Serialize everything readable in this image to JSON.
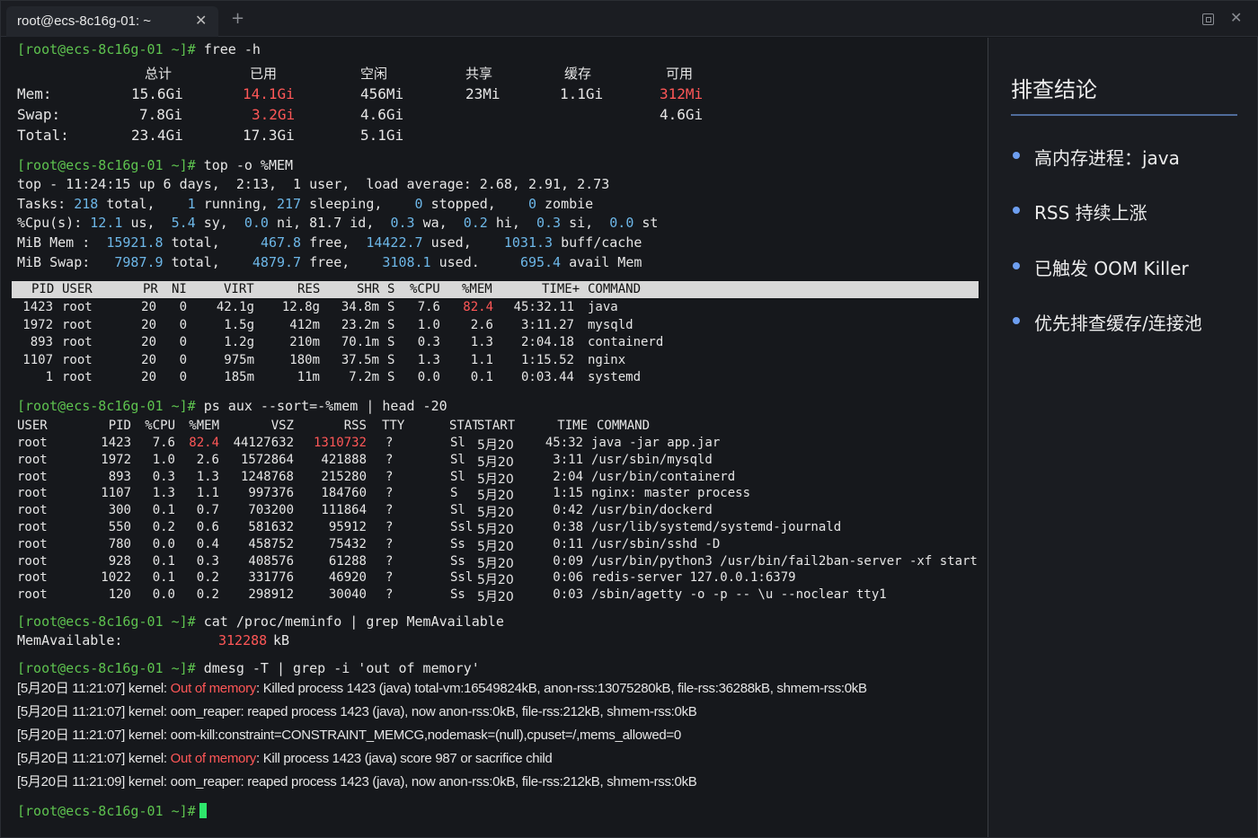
{
  "tab": {
    "title": "root@ecs-8c16g-01: ~",
    "close": "✕",
    "new": "+"
  },
  "window": {
    "close": "✕"
  },
  "prompt": "[root@ecs-8c16g-01 ~]#",
  "free": {
    "cmd": "free -h",
    "headers": [
      "总计",
      "已用",
      "空闲",
      "共享",
      "缓存",
      "可用"
    ],
    "mem": {
      "label": "Mem:",
      "total": "15.6Gi",
      "used": "14.1Gi",
      "free": "456Mi",
      "shared": "23Mi",
      "cache": "1.1Gi",
      "avail": "312Mi"
    },
    "swap": {
      "label": "Swap:",
      "total": "7.8Gi",
      "used": "3.2Gi",
      "free": "4.6Gi",
      "avail": "4.6Gi"
    },
    "total": {
      "label": "Total:",
      "total": "23.4Gi",
      "used": "17.3Gi",
      "free": "5.1Gi"
    }
  },
  "top": {
    "cmd": "top -o %MEM",
    "summary": "top - 11:24:15 up 6 days,  2:13,  1 user,  load average: 2.68, 2.91, 2.73",
    "tasks": {
      "label": "Tasks:",
      "total": "218",
      "total_l": "total,",
      "running": "1",
      "running_l": "running,",
      "sleeping": "217",
      "sleeping_l": "sleeping,",
      "stopped": "0",
      "stopped_l": "stopped,",
      "zombie": "0",
      "zombie_l": "zombie"
    },
    "cpu": {
      "label": "%Cpu(s):",
      "us": "12.1",
      "us_l": "us,",
      "sy": "5.4",
      "sy_l": "sy,",
      "ni": "0.0",
      "ni_l": "ni,",
      "id": "81.7",
      "id_l": "id,",
      "wa": "0.3",
      "wa_l": "wa,",
      "hi": "0.2",
      "hi_l": "hi,",
      "si": "0.3",
      "si_l": "si,",
      "st": "0.0",
      "st_l": "st"
    },
    "mem": {
      "label": "MiB Mem :",
      "total": "15921.8",
      "total_l": "total,",
      "free": "467.8",
      "free_l": "free,",
      "used": "14422.7",
      "used_l": "used,",
      "buff": "1031.3",
      "buff_l": "buff/cache"
    },
    "swap": {
      "label": "MiB Swap:",
      "total": "7987.9",
      "total_l": "total,",
      "free": "4879.7",
      "free_l": "free,",
      "used": "3108.1",
      "used_l": "used.",
      "avail": "695.4",
      "avail_l": "avail Mem"
    },
    "columns": [
      "PID",
      "USER",
      "PR",
      "NI",
      "VIRT",
      "RES",
      "SHR",
      "S",
      "%CPU",
      "%MEM",
      "TIME+",
      "COMMAND"
    ],
    "rows": [
      [
        "1423",
        "root",
        "20",
        "0",
        "42.1g",
        "12.8g",
        "34.8m",
        "S",
        "7.6",
        "82.4",
        "45:32.11",
        "java"
      ],
      [
        "1972",
        "root",
        "20",
        "0",
        "1.5g",
        "412m",
        "23.2m",
        "S",
        "1.0",
        "2.6",
        "3:11.27",
        "mysqld"
      ],
      [
        "893",
        "root",
        "20",
        "0",
        "1.2g",
        "210m",
        "70.1m",
        "S",
        "0.3",
        "1.3",
        "2:04.18",
        "containerd"
      ],
      [
        "1107",
        "root",
        "20",
        "0",
        "975m",
        "180m",
        "37.5m",
        "S",
        "1.3",
        "1.1",
        "1:15.52",
        "nginx"
      ],
      [
        "1",
        "root",
        "20",
        "0",
        "185m",
        "11m",
        "7.2m",
        "S",
        "0.0",
        "0.1",
        "0:03.44",
        "systemd"
      ]
    ]
  },
  "ps": {
    "cmd": "ps aux --sort=-%mem | head -20",
    "columns": [
      "USER",
      "PID",
      "%CPU",
      "%MEM",
      "VSZ",
      "RSS",
      "TTY",
      "STAT",
      "START",
      "TIME",
      "COMMAND"
    ],
    "rows": [
      [
        "root",
        "1423",
        "7.6",
        "82.4",
        "44127632",
        "1310732",
        "?",
        "Sl",
        "5月20",
        "45:32",
        "java -jar app.jar"
      ],
      [
        "root",
        "1972",
        "1.0",
        "2.6",
        "1572864",
        "421888",
        "?",
        "Sl",
        "5月20",
        "3:11",
        "/usr/sbin/mysqld"
      ],
      [
        "root",
        "893",
        "0.3",
        "1.3",
        "1248768",
        "215280",
        "?",
        "Sl",
        "5月20",
        "2:04",
        "/usr/bin/containerd"
      ],
      [
        "root",
        "1107",
        "1.3",
        "1.1",
        "997376",
        "184760",
        "?",
        "S",
        "5月20",
        "1:15",
        "nginx: master process"
      ],
      [
        "root",
        "300",
        "0.1",
        "0.7",
        "703200",
        "111864",
        "?",
        "Sl",
        "5月20",
        "0:42",
        "/usr/bin/dockerd"
      ],
      [
        "root",
        "550",
        "0.2",
        "0.6",
        "581632",
        "95912",
        "?",
        "Ssl",
        "5月20",
        "0:38",
        "/usr/lib/systemd/systemd-journald"
      ],
      [
        "root",
        "780",
        "0.0",
        "0.4",
        "458752",
        "75432",
        "?",
        "Ss",
        "5月20",
        "0:11",
        "/usr/sbin/sshd -D"
      ],
      [
        "root",
        "928",
        "0.1",
        "0.3",
        "408576",
        "61288",
        "?",
        "Ss",
        "5月20",
        "0:09",
        "/usr/bin/python3 /usr/bin/fail2ban-server -xf start"
      ],
      [
        "root",
        "1022",
        "0.1",
        "0.2",
        "331776",
        "46920",
        "?",
        "Ssl",
        "5月20",
        "0:06",
        "redis-server 127.0.0.1:6379"
      ],
      [
        "root",
        "120",
        "0.0",
        "0.2",
        "298912",
        "30040",
        "?",
        "Ss",
        "5月20",
        "0:03",
        "/sbin/agetty -o -p -- \\u --noclear tty1"
      ]
    ]
  },
  "meminfo": {
    "cmd": "cat /proc/meminfo | grep MemAvailable",
    "label": "MemAvailable:",
    "value": "312288",
    "unit": "kB"
  },
  "dmesg": {
    "cmd": "dmesg -T | grep -i 'out of memory'",
    "lines": [
      {
        "pre": "[5月20日 11:21:07] kernel: ",
        "hl": "Out of memory",
        "post": ": Killed process 1423 (java) total-vm:16549824kB, anon-rss:13075280kB, file-rss:36288kB, shmem-rss:0kB"
      },
      {
        "pre": "[5月20日 11:21:07] kernel: oom_reaper: reaped process 1423 (java), now anon-rss:0kB, file-rss:212kB, shmem-rss:0kB",
        "hl": "",
        "post": ""
      },
      {
        "pre": "[5月20日 11:21:07] kernel: oom-kill:constraint=CONSTRAINT_MEMCG,nodemask=(null),cpuset=/,mems_allowed=0",
        "hl": "",
        "post": ""
      },
      {
        "pre": "[5月20日 11:21:07] kernel: ",
        "hl": "Out of memory",
        "post": ": Kill process 1423 (java) score 987 or sacrifice child"
      },
      {
        "pre": "[5月20日 11:21:09] kernel: oom_reaper: reaped process 1423 (java), now anon-rss:0kB, file-rss:212kB, shmem-rss:0kB",
        "hl": "",
        "post": ""
      }
    ]
  },
  "panel": {
    "title": "排查结论",
    "items": [
      "高内存进程：java",
      "RSS 持续上涨",
      "已触发 OOM Killer",
      "优先排查缓存/连接池"
    ]
  },
  "colors": {
    "prompt": "#5ec34f",
    "highlight_red": "#ff5757",
    "value_blue": "#6db7e8",
    "cursor": "#2ee66b",
    "accent": "#6d9ef0"
  }
}
